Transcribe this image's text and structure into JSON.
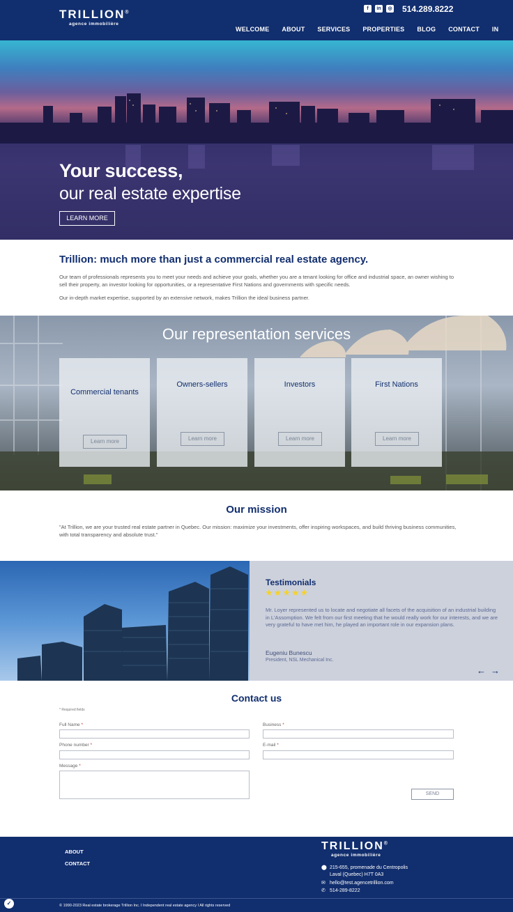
{
  "header": {
    "logo_name": "TRILLION",
    "logo_registered": "®",
    "logo_sub": "agence immobilière",
    "social": [
      {
        "icon": "facebook-icon",
        "glyph": "f"
      },
      {
        "icon": "linkedin-icon",
        "glyph": "in"
      },
      {
        "icon": "instagram-icon",
        "glyph": "◎"
      }
    ],
    "phone": "514.289.8222",
    "nav": [
      "WELCOME",
      "ABOUT",
      "SERVICES",
      "PROPERTIES",
      "BLOG",
      "CONTACT",
      "IN"
    ]
  },
  "hero": {
    "title": "Your success,",
    "subtitle": "our real estate expertise",
    "button": "LEARN MORE"
  },
  "about": {
    "title": "Trillion: much more than just a commercial real estate agency.",
    "p1": "Our team of professionals represents you to meet your needs and achieve your goals, whether you are a tenant looking for office and industrial space, an owner wishing to sell their property, an investor looking for opportunities, or a representative First Nations and governments with specific needs.",
    "p2": "Our in-depth market expertise, supported by an extensive network, makes Trillion the ideal business partner."
  },
  "services": {
    "title": "Our representation services",
    "cards": [
      {
        "title": "Commercial tenants",
        "button": "Learn more"
      },
      {
        "title": "Owners-sellers",
        "button": "Learn more"
      },
      {
        "title": "Investors",
        "button": "Learn more"
      },
      {
        "title": "First Nations",
        "button": "Learn more"
      }
    ]
  },
  "mission": {
    "title": "Our mission",
    "text": "\"At Trillion, we are your trusted real estate partner in Quebec. Our mission: maximize your investments, offer inspiring workspaces, and build thriving business communities, with total transparency and absolute trust.\""
  },
  "testimonials": {
    "title": "Testimonials",
    "rating": 5,
    "stars": "★★★★★",
    "text": "Mr. Loyer represented us to locate and negotiate all facets of the acquisition of an industrial building in L'Assomption. We felt from our first meeting that he would really work for our interests, and we are very grateful to have met him, he played an important role in our expansion plans.",
    "name": "Eugeniu Bunescu",
    "role": "President, NSL Mechanical Inc.",
    "prev": "←",
    "next": "→"
  },
  "contact": {
    "title": "Contact us",
    "required_note": "* Required fields",
    "full_name": "Full Name",
    "business": "Business",
    "phone": "Phone number",
    "email": "E-mail",
    "message": "Message",
    "asterisk": "*",
    "send": "SEND"
  },
  "footer": {
    "links": [
      "ABOUT",
      "CONTACT"
    ],
    "logo_name": "TRILLION",
    "logo_registered": "®",
    "logo_sub": "agence immobilière",
    "address1": "215-655, promenade du Centropolis",
    "address2": "Laval (Quebec) H7T 0A3",
    "email": "hello@test.agencetrillion.com",
    "phone": "514-289-8222",
    "copyright": "© 1990-2023 Real estate brokerage Trillion Inc. I Independent real estate agency I All rights reserved"
  }
}
